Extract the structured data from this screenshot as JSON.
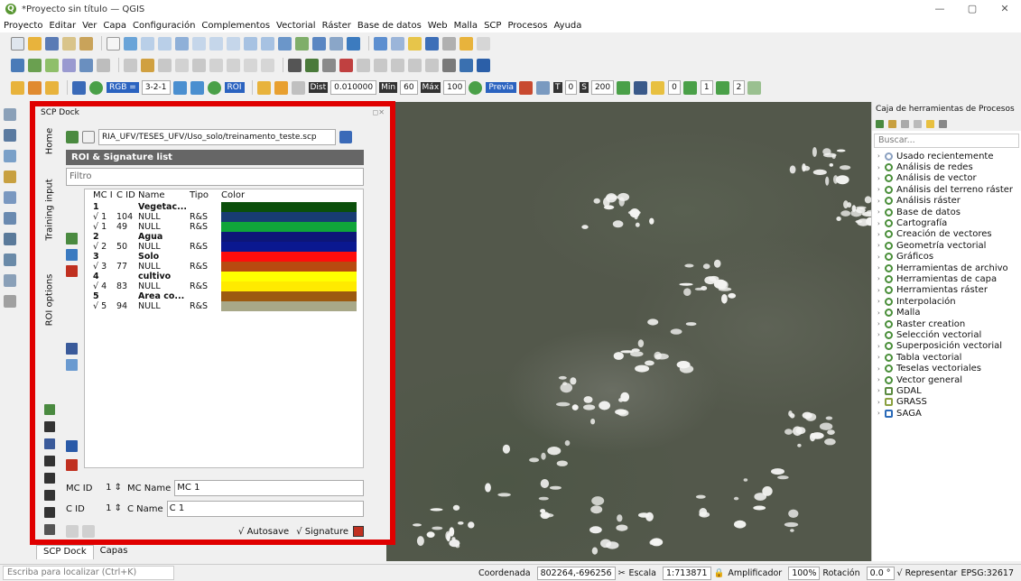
{
  "window": {
    "title": "*Proyecto sin título — QGIS"
  },
  "menu": [
    "Proyecto",
    "Editar",
    "Ver",
    "Capa",
    "Configuración",
    "Complementos",
    "Vectorial",
    "Ráster",
    "Base de datos",
    "Web",
    "Malla",
    "SCP",
    "Procesos",
    "Ayuda"
  ],
  "scp_toolbar": {
    "rgb_label": "RGB =",
    "rgb_value": "3-2-1",
    "roi_label": "ROI",
    "dist_label": "Dist",
    "dist_value": "0.010000",
    "min_label": "Min",
    "min_value": "60",
    "max_label": "Máx",
    "max_value": "100",
    "preview_label": "Previa",
    "t_label": "T",
    "t_value": "0",
    "s_label": "S",
    "s_value": "200",
    "band_values": [
      "0",
      "1",
      "2"
    ]
  },
  "dock": {
    "title": "SCP Dock",
    "tabs": [
      "Home",
      "Training input",
      "ROI options"
    ],
    "path": "RIA_UFV/TESES_UFV/Uso_solo/treinamento_teste.scp",
    "header": "ROI & Signature list",
    "filter_placeholder": "Filtro",
    "columns": [
      "MC I",
      "C ID",
      "Name",
      "Tipo",
      "Color"
    ],
    "rows": [
      {
        "mc": "1",
        "cid": "",
        "name": "Vegetac...",
        "tipo": "",
        "color": "#0b4f0b",
        "bold": true
      },
      {
        "mc": "√ 1",
        "cid": "104",
        "name": "NULL",
        "tipo": "R&S",
        "color": "#183c73",
        "bold": false
      },
      {
        "mc": "√ 1",
        "cid": "49",
        "name": "NULL",
        "tipo": "R&S",
        "color": "#10a53a",
        "bold": false
      },
      {
        "mc": "2",
        "cid": "",
        "name": "Agua",
        "tipo": "",
        "color": "#0d1678",
        "bold": true
      },
      {
        "mc": "√ 2",
        "cid": "50",
        "name": "NULL",
        "tipo": "R&S",
        "color": "#0a1890",
        "bold": false
      },
      {
        "mc": "3",
        "cid": "",
        "name": "Solo",
        "tipo": "",
        "color": "#ff0d0d",
        "bold": true
      },
      {
        "mc": "√ 3",
        "cid": "77",
        "name": "NULL",
        "tipo": "R&S",
        "color": "#b84a10",
        "bold": false
      },
      {
        "mc": "4",
        "cid": "",
        "name": "cultivo",
        "tipo": "",
        "color": "#ffff00",
        "bold": true
      },
      {
        "mc": "√ 4",
        "cid": "83",
        "name": "NULL",
        "tipo": "R&S",
        "color": "#ffea00",
        "bold": false
      },
      {
        "mc": "5",
        "cid": "",
        "name": "Area co...",
        "tipo": "",
        "color": "#9c5a10",
        "bold": true
      },
      {
        "mc": "√ 5",
        "cid": "94",
        "name": "NULL",
        "tipo": "R&S",
        "color": "#a8a888",
        "bold": false
      }
    ],
    "mc_id_label": "MC ID",
    "mc_id_value": "1",
    "mc_name_label": "MC Name",
    "mc_name_value": "MC 1",
    "c_id_label": "C ID",
    "c_id_value": "1",
    "c_name_label": "C Name",
    "c_name_value": "C 1",
    "autosave_label": "√ Autosave",
    "signature_label": "√ Signature",
    "bottom_tabs": [
      "SCP Dock",
      "Capas"
    ]
  },
  "toolbox": {
    "title": "Caja de herramientas de Procesos",
    "search_placeholder": "Buscar...",
    "items": [
      "Usado recientemente",
      "Análisis de redes",
      "Análisis de vector",
      "Análisis del terreno ráster",
      "Análisis ráster",
      "Base de datos",
      "Cartografía",
      "Creación de vectores",
      "Geometría vectorial",
      "Gráficos",
      "Herramientas de archivo",
      "Herramientas de capa",
      "Herramientas ráster",
      "Interpolación",
      "Malla",
      "Raster creation",
      "Selección vectorial",
      "Superposición vectorial",
      "Tabla vectorial",
      "Teselas vectoriales",
      "Vector general",
      "GDAL",
      "GRASS",
      "SAGA"
    ]
  },
  "statusbar": {
    "locator_placeholder": "Escriba para localizar (Ctrl+K)",
    "coord_label": "Coordenada",
    "coord_value": "802264,-696256",
    "scale_label": "Escala",
    "scale_value": "1:713871",
    "magnifier_label": "Amplificador",
    "magnifier_value": "100%",
    "rotation_label": "Rotación",
    "rotation_value": "0.0 °",
    "render_label": "√ Representar",
    "crs": "EPSG:32617"
  }
}
